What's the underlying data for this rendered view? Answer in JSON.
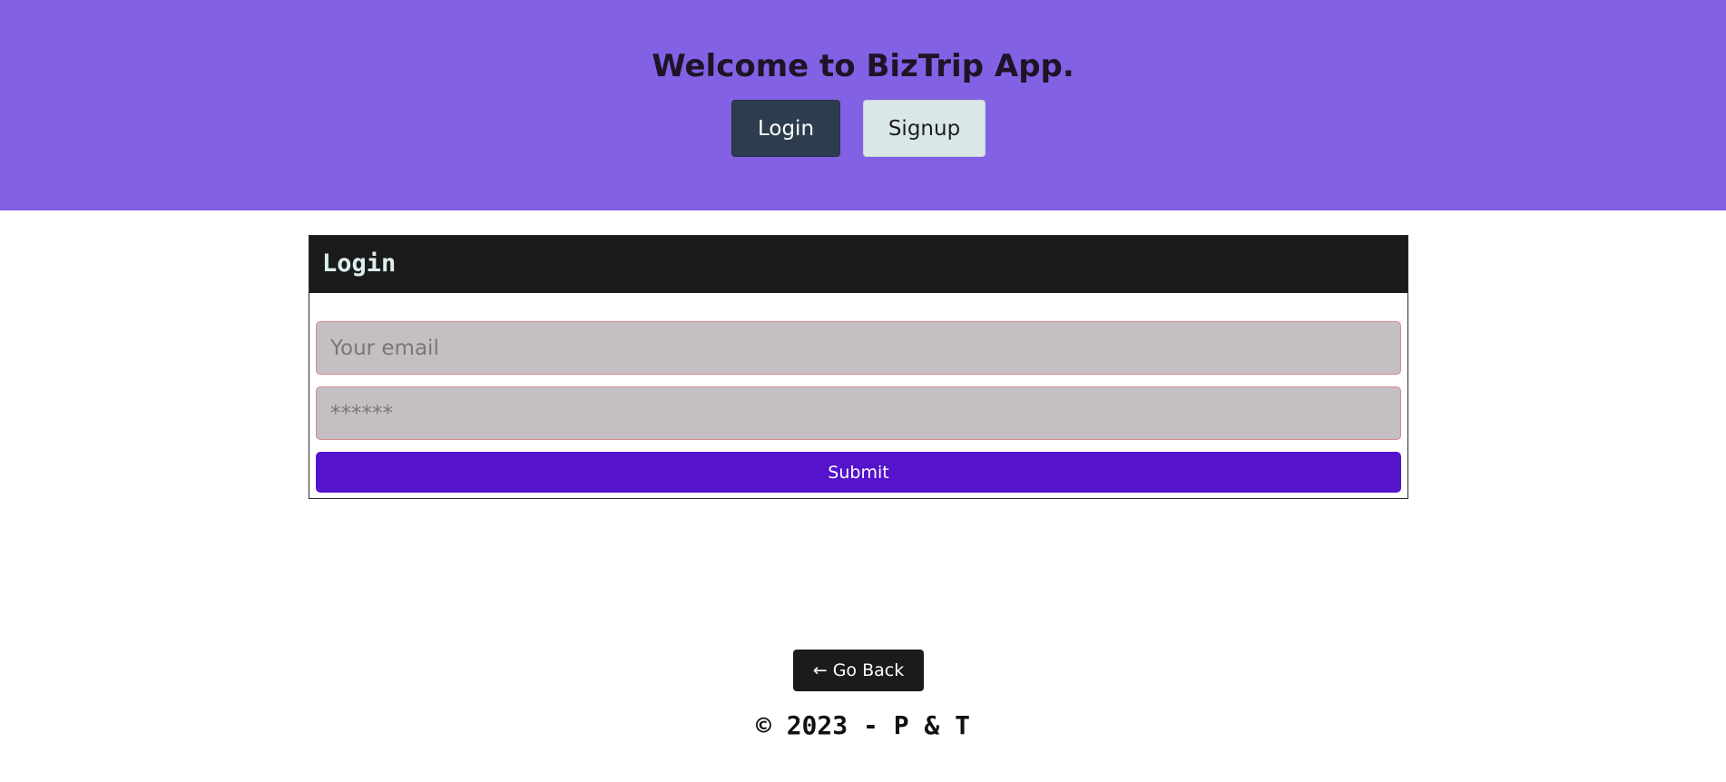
{
  "hero": {
    "title": "Welcome to BizTrip App.",
    "login_label": "Login",
    "signup_label": "Signup",
    "background_color": "#8361e4"
  },
  "login_card": {
    "title": "Login",
    "email_placeholder": "Your email",
    "password_placeholder": "******",
    "submit_label": "Submit",
    "submit_color": "#5513cc"
  },
  "back_button": {
    "label": "← Go Back"
  },
  "footer": {
    "text": "© 2023 - P & T"
  }
}
